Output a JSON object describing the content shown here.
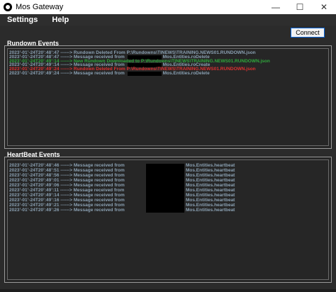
{
  "window": {
    "title": "Mos Gateway",
    "minimize": "—",
    "maximize": "☐",
    "close": "✕"
  },
  "menu": {
    "items": [
      "Settings",
      "Help"
    ]
  },
  "toolbar": {
    "connect_label": "Connect"
  },
  "colors": {
    "gray": "#8aa0b2",
    "green": "#2fa83c",
    "red": "#e03131"
  },
  "rundown": {
    "title": "Rundown Events",
    "lines": [
      {
        "ts": "2023’-01’-24T20’:48’:47",
        "msg": "------> Rundown Deleted From",
        "target": "P:\\Rundowns\\TINEWS\\TRAINING.NEWS01.RUNDOWN.json",
        "suffix": "",
        "color": "gray",
        "redact": false
      },
      {
        "ts": "2023’-01’-24T20’:48’:47",
        "msg": "------> Message received from",
        "target": "",
        "suffix": "Mos.Entities.roDelete",
        "color": "gray",
        "redact": true
      },
      {
        "ts": "2023’-01’-24T20’:49’:14",
        "msg": "------> New Rundown Downloaded to",
        "target": "P:\\Rundowns\\TINEWS\\TRAINING.NEWS01.RUNDOWN.json",
        "suffix": "",
        "color": "green",
        "redact": false
      },
      {
        "ts": "2023’-01’-24T20’:49’:14",
        "msg": "------> Message received from",
        "target": "",
        "suffix": "Mos.Entities.roCreate",
        "color": "gray",
        "redact": true
      },
      {
        "ts": "2023’-01’-24T20’:49’:24",
        "msg": "------> Rundown Deleted From",
        "target": "P:\\Rundowns\\TINEWS\\TRAINING.NEWS01.RUNDOWN.json",
        "suffix": "",
        "color": "red",
        "redact": false
      },
      {
        "ts": "2023’-01’-24T20’:49’:24",
        "msg": "------> Message received from",
        "target": "",
        "suffix": "Mos.Entities.roDelete",
        "color": "gray",
        "redact": true
      }
    ]
  },
  "heartbeat": {
    "title": "HeartBeat Events",
    "lines": [
      {
        "ts": "2023’-01’-24T20’:48’:46",
        "msg": "------> Message received from",
        "suffix": "Mos.Entities.heartbeat"
      },
      {
        "ts": "2023’-01’-24T20’:48’:51",
        "msg": "------> Message received from",
        "suffix": "Mos.Entities.heartbeat"
      },
      {
        "ts": "2023’-01’-24T20’:48’:56",
        "msg": "------> Message received from",
        "suffix": "Mos.Entities.heartbeat"
      },
      {
        "ts": "2023’-01’-24T20’:49’:01",
        "msg": "------> Message received from",
        "suffix": "Mos.Entities.heartbeat"
      },
      {
        "ts": "2023’-01’-24T20’:49’:06",
        "msg": "------> Message received from",
        "suffix": "Mos.Entities.heartbeat"
      },
      {
        "ts": "2023’-01’-24T20’:49’:11",
        "msg": "------> Message received from",
        "suffix": "Mos.Entities.heartbeat"
      },
      {
        "ts": "2023’-01’-24T20’:49’:14",
        "msg": "------> Message received from",
        "suffix": "Mos.Entities.heartbeat"
      },
      {
        "ts": "2023’-01’-24T20’:49’:16",
        "msg": "------> Message received from",
        "suffix": "Mos.Entities.heartbeat"
      },
      {
        "ts": "2023’-01’-24T20’:49’:21",
        "msg": "------> Message received from",
        "suffix": "Mos.Entities.heartbeat"
      },
      {
        "ts": "2023’-01’-24T20’:49’:26",
        "msg": "------> Message received from",
        "suffix": "Mos.Entities.heartbeat"
      }
    ]
  }
}
